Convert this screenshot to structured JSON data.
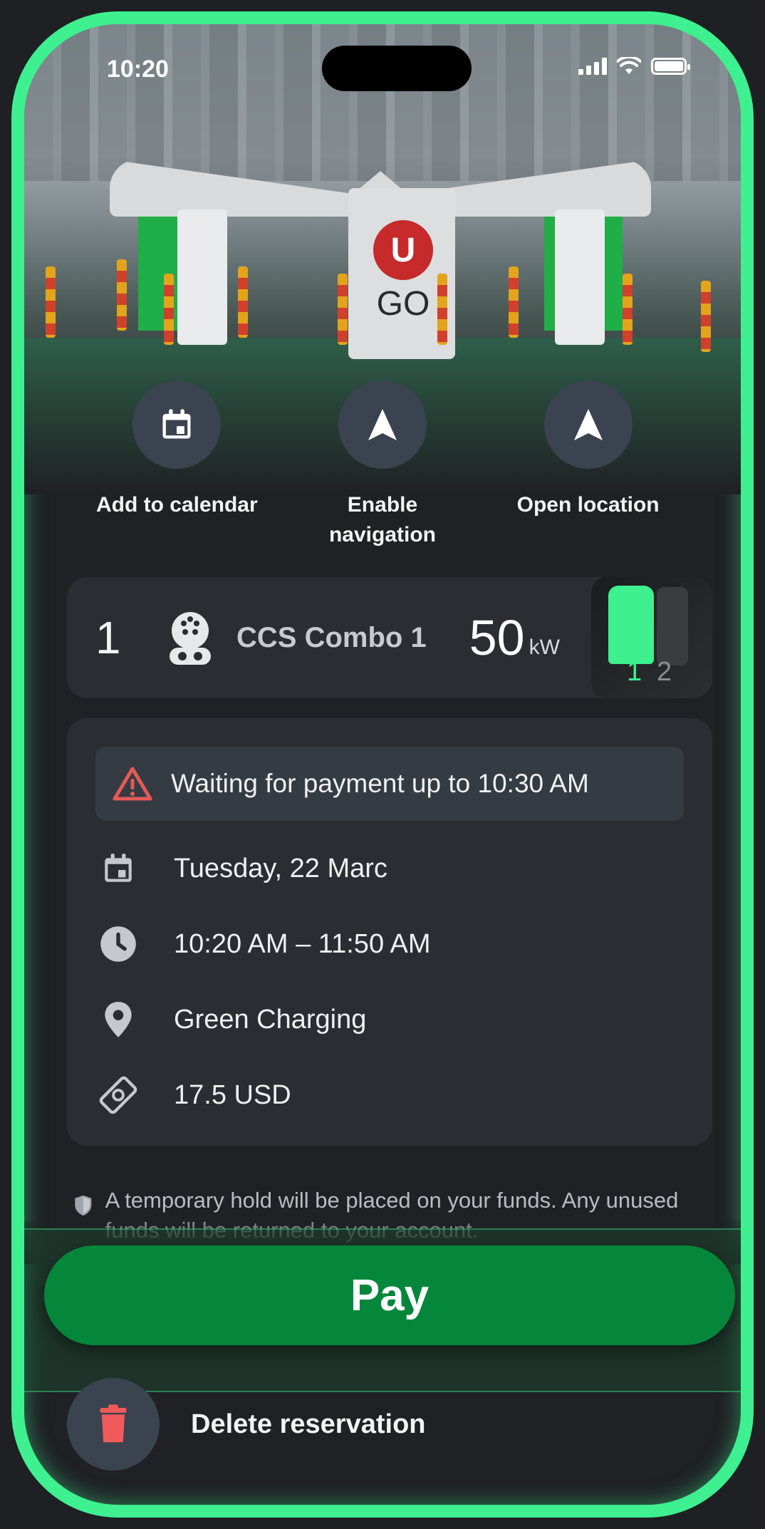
{
  "status_bar": {
    "time": "10:20",
    "signal_icon": "cellular-signal-icon",
    "wifi_icon": "wifi-icon",
    "battery_icon": "battery-icon"
  },
  "hero": {
    "logo_mark": "U",
    "logo_text": "GO"
  },
  "actions": [
    {
      "label": "Add to calendar",
      "icon": "calendar-icon"
    },
    {
      "label": "Enable navigation",
      "icon": "navigation-arrow-icon"
    },
    {
      "label": "Open location",
      "icon": "navigation-arrow-icon"
    }
  ],
  "connector": {
    "number": "1",
    "icon": "ccs-plug-icon",
    "name": "CCS Combo 1",
    "power": "50",
    "unit": "kW",
    "thumb_label_active": "1",
    "thumb_label_other": "2"
  },
  "details": {
    "warning": "Waiting for payment up to 10:30 AM",
    "date": "Tuesday, 22 Marc",
    "time_range": "10:20 AM – 11:50 AM",
    "location": "Green Charging",
    "price": "17.5 USD"
  },
  "disclaimer": "A temporary hold will be placed on your funds. Any unused funds will be returned to your account.",
  "pay_button": "Pay",
  "delete_label": "Delete reservation",
  "colors": {
    "accent": "#3ef08f",
    "pay": "#04873a",
    "warning": "#e55a57",
    "card": "#2a2d31",
    "circle": "#3b4350"
  }
}
